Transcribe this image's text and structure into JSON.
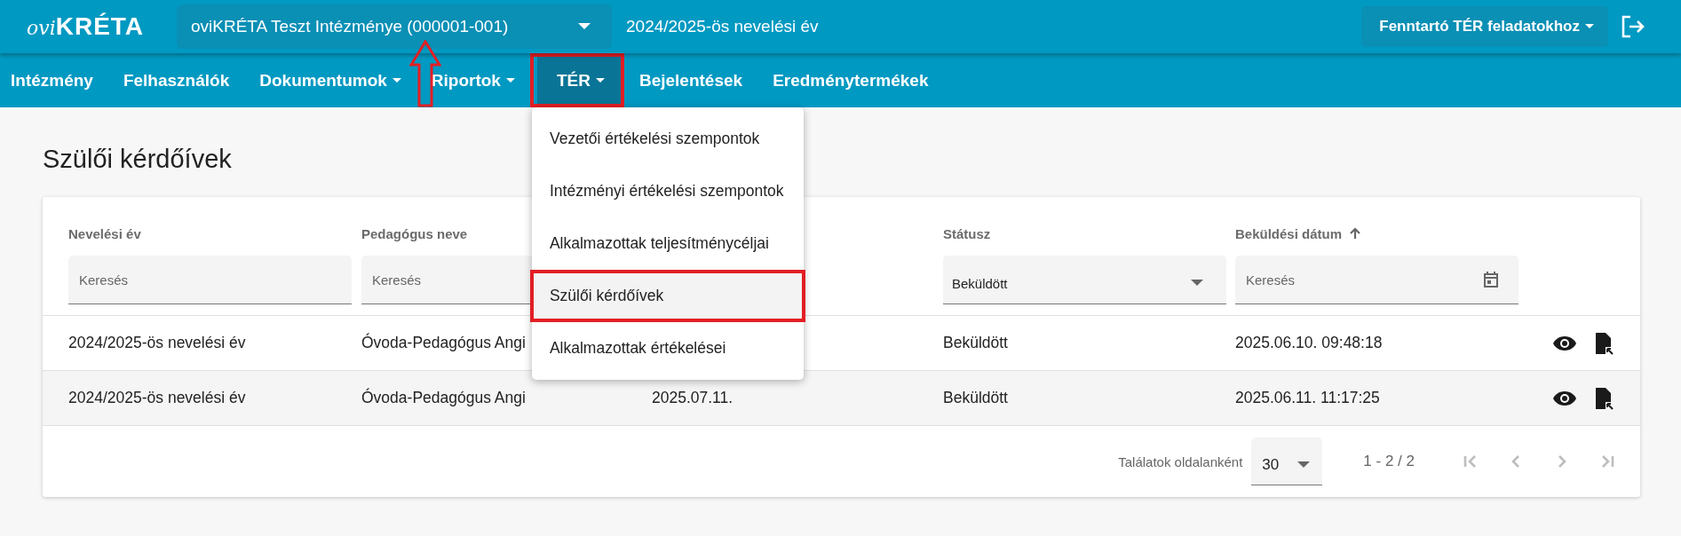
{
  "header": {
    "logo": {
      "prefix": "ovi",
      "name": "KRÉTA"
    },
    "institution_select": {
      "value": "oviKRÉTA Teszt Intézménye (000001-001)",
      "annotated": true
    },
    "school_year": "2024/2025-ös nevelési év",
    "role_button": "Fenntartó TÉR feladatokhoz"
  },
  "nav": [
    {
      "label": "Intézmény",
      "has_dropdown": false,
      "selected": false,
      "annotated": false
    },
    {
      "label": "Felhasználók",
      "has_dropdown": false,
      "selected": false,
      "annotated": false
    },
    {
      "label": "Dokumentumok",
      "has_dropdown": true,
      "selected": false,
      "annotated": false
    },
    {
      "label": "Riportok",
      "has_dropdown": true,
      "selected": false,
      "annotated": false
    },
    {
      "label": "TÉR",
      "has_dropdown": true,
      "selected": true,
      "annotated": true
    },
    {
      "label": "Bejelentések",
      "has_dropdown": false,
      "selected": false,
      "annotated": false
    },
    {
      "label": "Eredménytermékek",
      "has_dropdown": false,
      "selected": false,
      "annotated": false
    }
  ],
  "dropdown_menu": {
    "items": [
      {
        "label": "Vezetői értékelési szempontok",
        "selected": false,
        "annotated": false
      },
      {
        "label": "Intézményi értékelési szempontok",
        "selected": false,
        "annotated": false
      },
      {
        "label": "Alkalmazottak teljesítménycéljai",
        "selected": false,
        "annotated": false
      },
      {
        "label": "Szülői kérdőívek",
        "selected": true,
        "annotated": true
      },
      {
        "label": "Alkalmazottak értékelései",
        "selected": false,
        "annotated": false
      }
    ]
  },
  "page_title": "Szülői kérdőívek",
  "table": {
    "columns": [
      {
        "heading": "Nevelési év",
        "filter": {
          "kind": "text",
          "placeholder": "Keresés"
        }
      },
      {
        "heading": "Pedagógus neve",
        "filter": {
          "kind": "text",
          "placeholder": "Keresés"
        }
      },
      {},
      {
        "heading": "Státusz",
        "filter": {
          "kind": "select",
          "value": "Beküldött"
        }
      },
      {
        "heading": "Beküldési dátum",
        "sorted": true,
        "filter": {
          "kind": "date",
          "placeholder": "Keresés"
        }
      }
    ],
    "rows": [
      {
        "highlighted": false,
        "cells": [
          "2024/2025-ös nevelési év",
          "Óvoda-Pedagógus Angi",
          null,
          "Beküldött",
          "2025.06.10. 09:48:18"
        ]
      },
      {
        "highlighted": true,
        "cells": [
          "2024/2025-ös nevelési év",
          "Óvoda-Pedagógus Angi",
          "2025.07.11.",
          "Beküldött",
          "2025.06.11. 11:17:25"
        ]
      }
    ]
  },
  "pagination": {
    "label": "Találatok oldalanként",
    "page_size": "30",
    "range": "1 - 2 / 2",
    "buttons": [
      {
        "kind": "first",
        "disabled": true
      },
      {
        "kind": "prev",
        "disabled": true
      },
      {
        "kind": "next",
        "disabled": true
      },
      {
        "kind": "last",
        "disabled": true
      }
    ]
  }
}
